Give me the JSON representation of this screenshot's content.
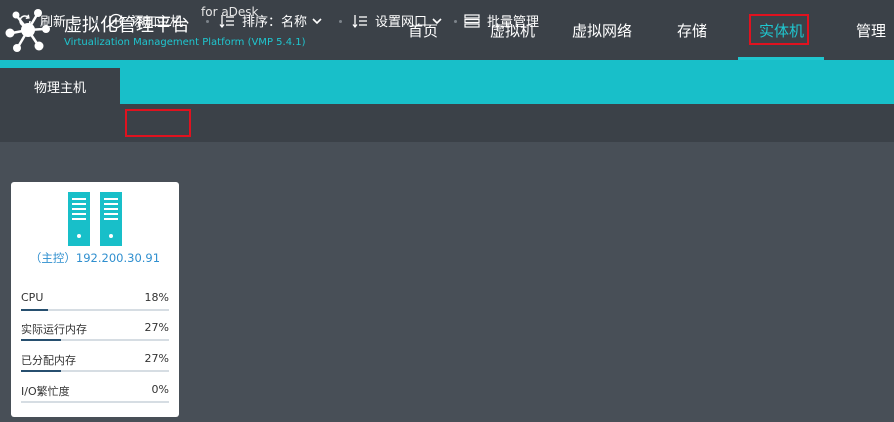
{
  "brand": {
    "title": "虚拟化管理平台",
    "for_text": "for aDesk",
    "subtitle": "Virtualization Management Platform (VMP 5.4.1)"
  },
  "nav": {
    "home": "首页",
    "vm": "虚拟机",
    "vnet": "虚拟网络",
    "storage": "存储",
    "physical": "实体机",
    "manage": "管理"
  },
  "tabs": {
    "physical_host": "物理主机"
  },
  "toolbar": {
    "refresh": "刷新",
    "add_host": "添加主机",
    "sort_label": "排序：名称",
    "set_nic": "设置网口",
    "batch": "批量管理"
  },
  "card": {
    "ip_label": "（主控）192.200.30.91",
    "metrics": [
      {
        "label": "CPU",
        "value": "18%",
        "percent": 18
      },
      {
        "label": "实际运行内存",
        "value": "27%",
        "percent": 27
      },
      {
        "label": "已分配内存",
        "value": "27%",
        "percent": 27
      },
      {
        "label": "I/O繁忙度",
        "value": "0%",
        "percent": 0
      }
    ]
  },
  "colors": {
    "accent": "#1fc6cf",
    "header_bg": "#3b4148",
    "content_bg": "#484f57",
    "highlight_border": "#e0121f",
    "ip_link": "#2f8fcf"
  },
  "icons": {
    "logo": "network-logo-icon",
    "refresh": "refresh-icon",
    "add": "plus-circle-icon",
    "sort": "sort-icon",
    "nic": "sort-icon",
    "batch": "list-icon",
    "server": "server-icon"
  }
}
